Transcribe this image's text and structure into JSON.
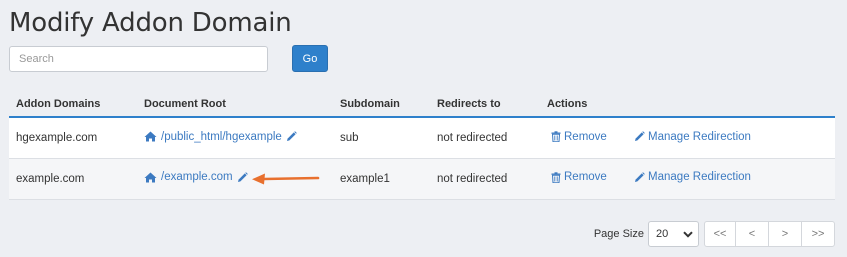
{
  "page": {
    "title": "Modify Addon Domain"
  },
  "search": {
    "placeholder": "Search",
    "value": "",
    "go_label": "Go"
  },
  "table": {
    "columns": [
      "Addon Domains",
      "Document Root",
      "Subdomain",
      "Redirects to",
      "Actions"
    ],
    "rows": [
      {
        "domain": "hgexample.com",
        "doc_root": "/public_html/hgexample",
        "subdomain": "sub",
        "redirects": "not redirected",
        "remove_label": "Remove",
        "manage_label": "Manage Redirection"
      },
      {
        "domain": "example.com",
        "doc_root": "/example.com",
        "subdomain": "example1",
        "redirects": "not redirected",
        "remove_label": "Remove",
        "manage_label": "Manage Redirection"
      }
    ]
  },
  "pager": {
    "page_size_label": "Page Size",
    "page_size_value": "20",
    "buttons": [
      "<<",
      "<",
      ">",
      ">>"
    ]
  },
  "colors": {
    "accent": "#2e80cb",
    "link": "#3c7ac1",
    "annotation_arrow": "#e8702e"
  },
  "icons": {
    "home": "home-icon",
    "edit": "pencil-icon",
    "remove": "trash-icon",
    "dropdown": "chevron-down-icon"
  }
}
